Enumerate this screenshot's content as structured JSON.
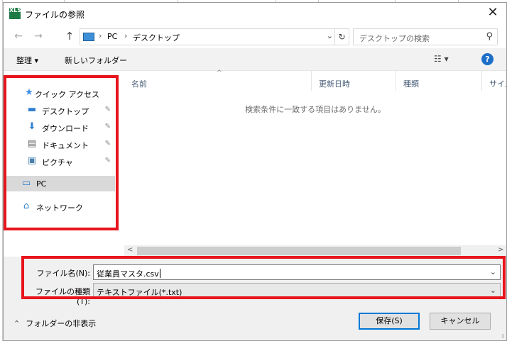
{
  "window": {
    "title": "ファイルの参照",
    "close_glyph": "✕",
    "app_icon_text": "XLS"
  },
  "nav": {
    "back_glyph": "←",
    "forward_glyph": "→",
    "up_glyph": "↑",
    "breadcrumb": [
      "PC",
      "デスクトップ"
    ],
    "breadcrumb_sep": "›",
    "dropdown_glyph": "⌄",
    "refresh_glyph": "↻",
    "search_placeholder": "デスクトップの検索",
    "search_glyph": "⚲"
  },
  "toolbar": {
    "organize_label": "整理 ▾",
    "new_folder_label": "新しいフォルダー",
    "view_glyph": "☷ ▾",
    "help_glyph": "?"
  },
  "sidebar": {
    "items": [
      {
        "label": "クイック アクセス",
        "icon": "star-icon",
        "glyph": "★",
        "color": "#3a8ee6",
        "pinned": false
      },
      {
        "label": "デスクトップ",
        "icon": "desktop-icon",
        "glyph": "▬",
        "color": "#2f7fd0",
        "pinned": true
      },
      {
        "label": "ダウンロード",
        "icon": "download-icon",
        "glyph": "⬇",
        "color": "#2f7fd0",
        "pinned": true
      },
      {
        "label": "ドキュメント",
        "icon": "document-icon",
        "glyph": "▤",
        "color": "#666666",
        "pinned": true
      },
      {
        "label": "ピクチャ",
        "icon": "picture-icon",
        "glyph": "▣",
        "color": "#4a7fae",
        "pinned": true
      },
      {
        "label": "PC",
        "icon": "pc-icon",
        "glyph": "▭",
        "color": "#2f7fd0",
        "pinned": false
      },
      {
        "label": "ネットワーク",
        "icon": "network-icon",
        "glyph": "⌂",
        "color": "#2f7fd0",
        "pinned": false
      }
    ],
    "pin_glyph": "✎"
  },
  "filelist": {
    "columns": [
      "名前",
      "更新日時",
      "種類",
      "サイズ"
    ],
    "sort_glyph": "^",
    "empty_message": "検索条件に一致する項目はありません。",
    "scroll_left": "<",
    "scroll_right": ">"
  },
  "form": {
    "filename_label": "ファイル名(N):",
    "filename_value": "従業員マスタ.csv",
    "filetype_label": "ファイルの種類(T):",
    "filetype_value": "テキストファイル(*.txt)",
    "chevron": "⌄"
  },
  "buttons": {
    "save": "保存(S)",
    "cancel": "キャンセル",
    "hide_folders": "フォルダーの非表示",
    "hide_folders_glyph": "⌃"
  },
  "colors": {
    "highlight": "#e8141b",
    "accent": "#0078d7"
  }
}
